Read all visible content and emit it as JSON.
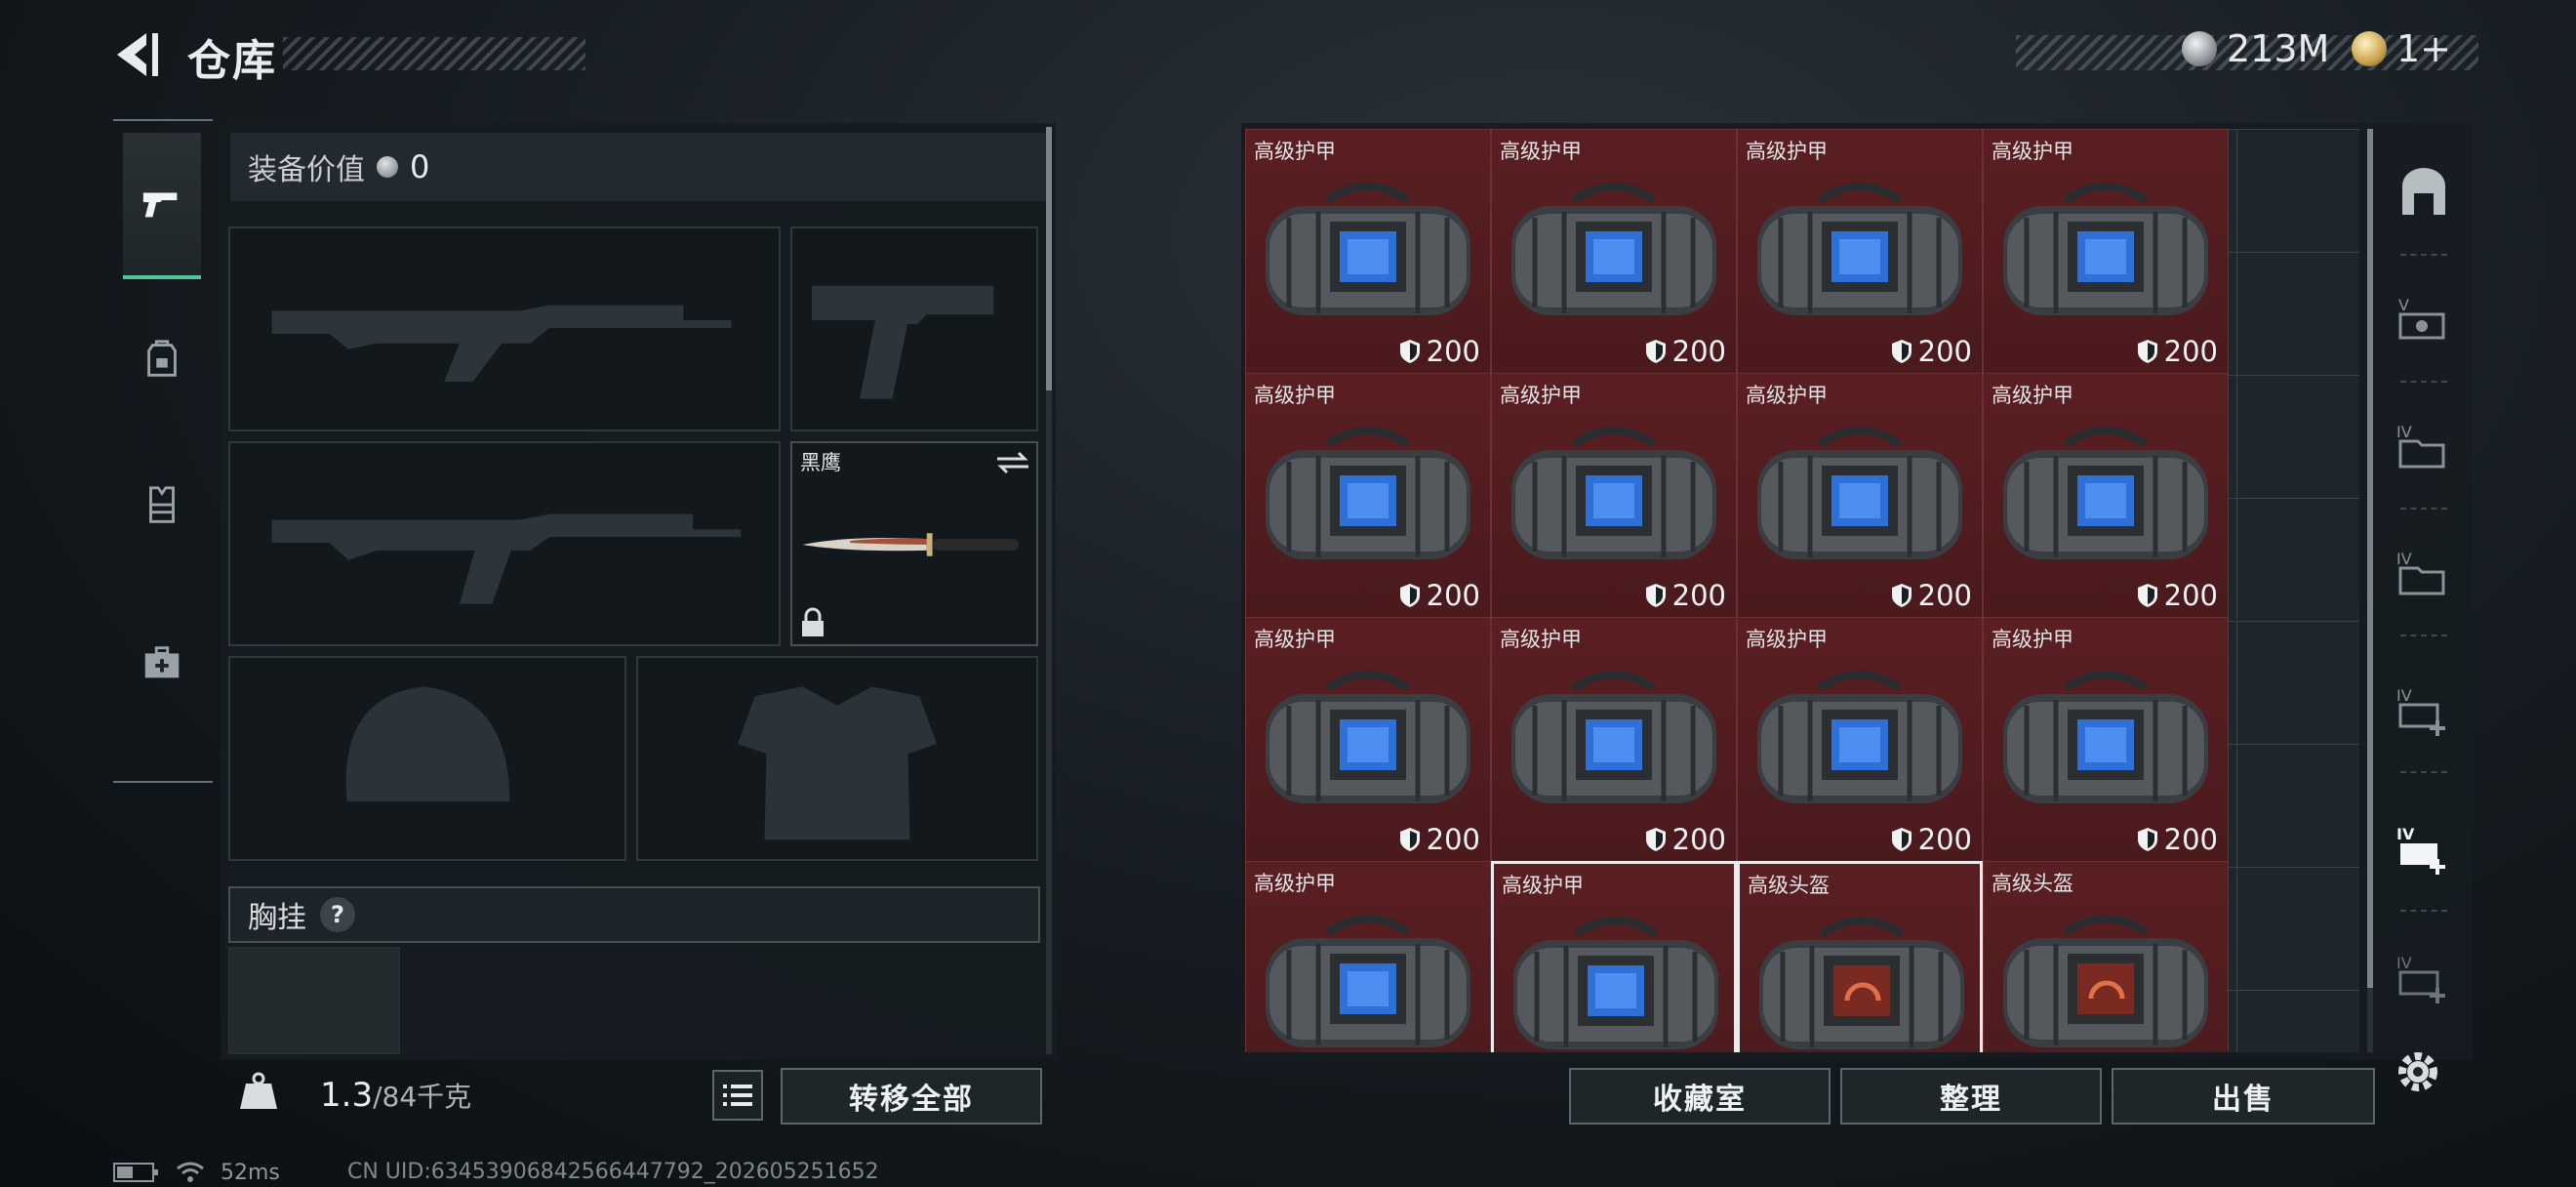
{
  "header": {
    "title": "仓库",
    "currencies": [
      {
        "icon": "silver-coin-icon",
        "value": "213M"
      },
      {
        "icon": "gold-coin-icon",
        "value": "1+"
      }
    ]
  },
  "tabs": [
    {
      "icon": "pistol-icon",
      "active": true
    },
    {
      "icon": "backpack-icon",
      "active": false
    },
    {
      "icon": "vest-icon",
      "active": false
    },
    {
      "icon": "medkit-icon",
      "active": false
    }
  ],
  "equipment": {
    "value_label": "装备价值",
    "value": "0",
    "melee_name": "黑鹰",
    "chest_rig_label": "胸挂",
    "help": "?",
    "weight": "1.3",
    "weight_max": "/84千克",
    "transfer_all": "转移全部"
  },
  "storage": {
    "items": [
      {
        "label": "高级护甲",
        "value": "200",
        "type": "armor"
      },
      {
        "label": "高级护甲",
        "value": "200",
        "type": "armor"
      },
      {
        "label": "高级护甲",
        "value": "200",
        "type": "armor"
      },
      {
        "label": "高级护甲",
        "value": "200",
        "type": "armor"
      },
      {
        "label": "高级护甲",
        "value": "200",
        "type": "armor"
      },
      {
        "label": "高级护甲",
        "value": "200",
        "type": "armor"
      },
      {
        "label": "高级护甲",
        "value": "200",
        "type": "armor"
      },
      {
        "label": "高级护甲",
        "value": "200",
        "type": "armor"
      },
      {
        "label": "高级护甲",
        "value": "200",
        "type": "armor"
      },
      {
        "label": "高级护甲",
        "value": "200",
        "type": "armor"
      },
      {
        "label": "高级护甲",
        "value": "200",
        "type": "armor"
      },
      {
        "label": "高级护甲",
        "value": "200",
        "type": "armor"
      },
      {
        "label": "高级护甲",
        "value": "",
        "type": "armor"
      },
      {
        "label": "高级护甲",
        "value": "",
        "type": "armor",
        "selected": true
      },
      {
        "label": "高级头盔",
        "value": "",
        "type": "helmet",
        "selected": true
      },
      {
        "label": "高级头盔",
        "value": "",
        "type": "helmet"
      }
    ],
    "buttons": {
      "collection": "收藏室",
      "organize": "整理",
      "sell": "出售"
    },
    "side_icons": [
      "stash-icon",
      "storage-v-icon",
      "storage-iv-icon",
      "storage-iv-icon",
      "storage-iv-add-icon",
      "storage-iv-add-icon",
      "storage-iv-add-icon"
    ]
  },
  "status_bar": {
    "ping": "52ms",
    "uid": "CN UID:634539068425664477​92_202605251652"
  },
  "colors": {
    "accent": "#4fc59a",
    "cell_bg": "#5a1f22",
    "panel_bg": "#161c21"
  }
}
